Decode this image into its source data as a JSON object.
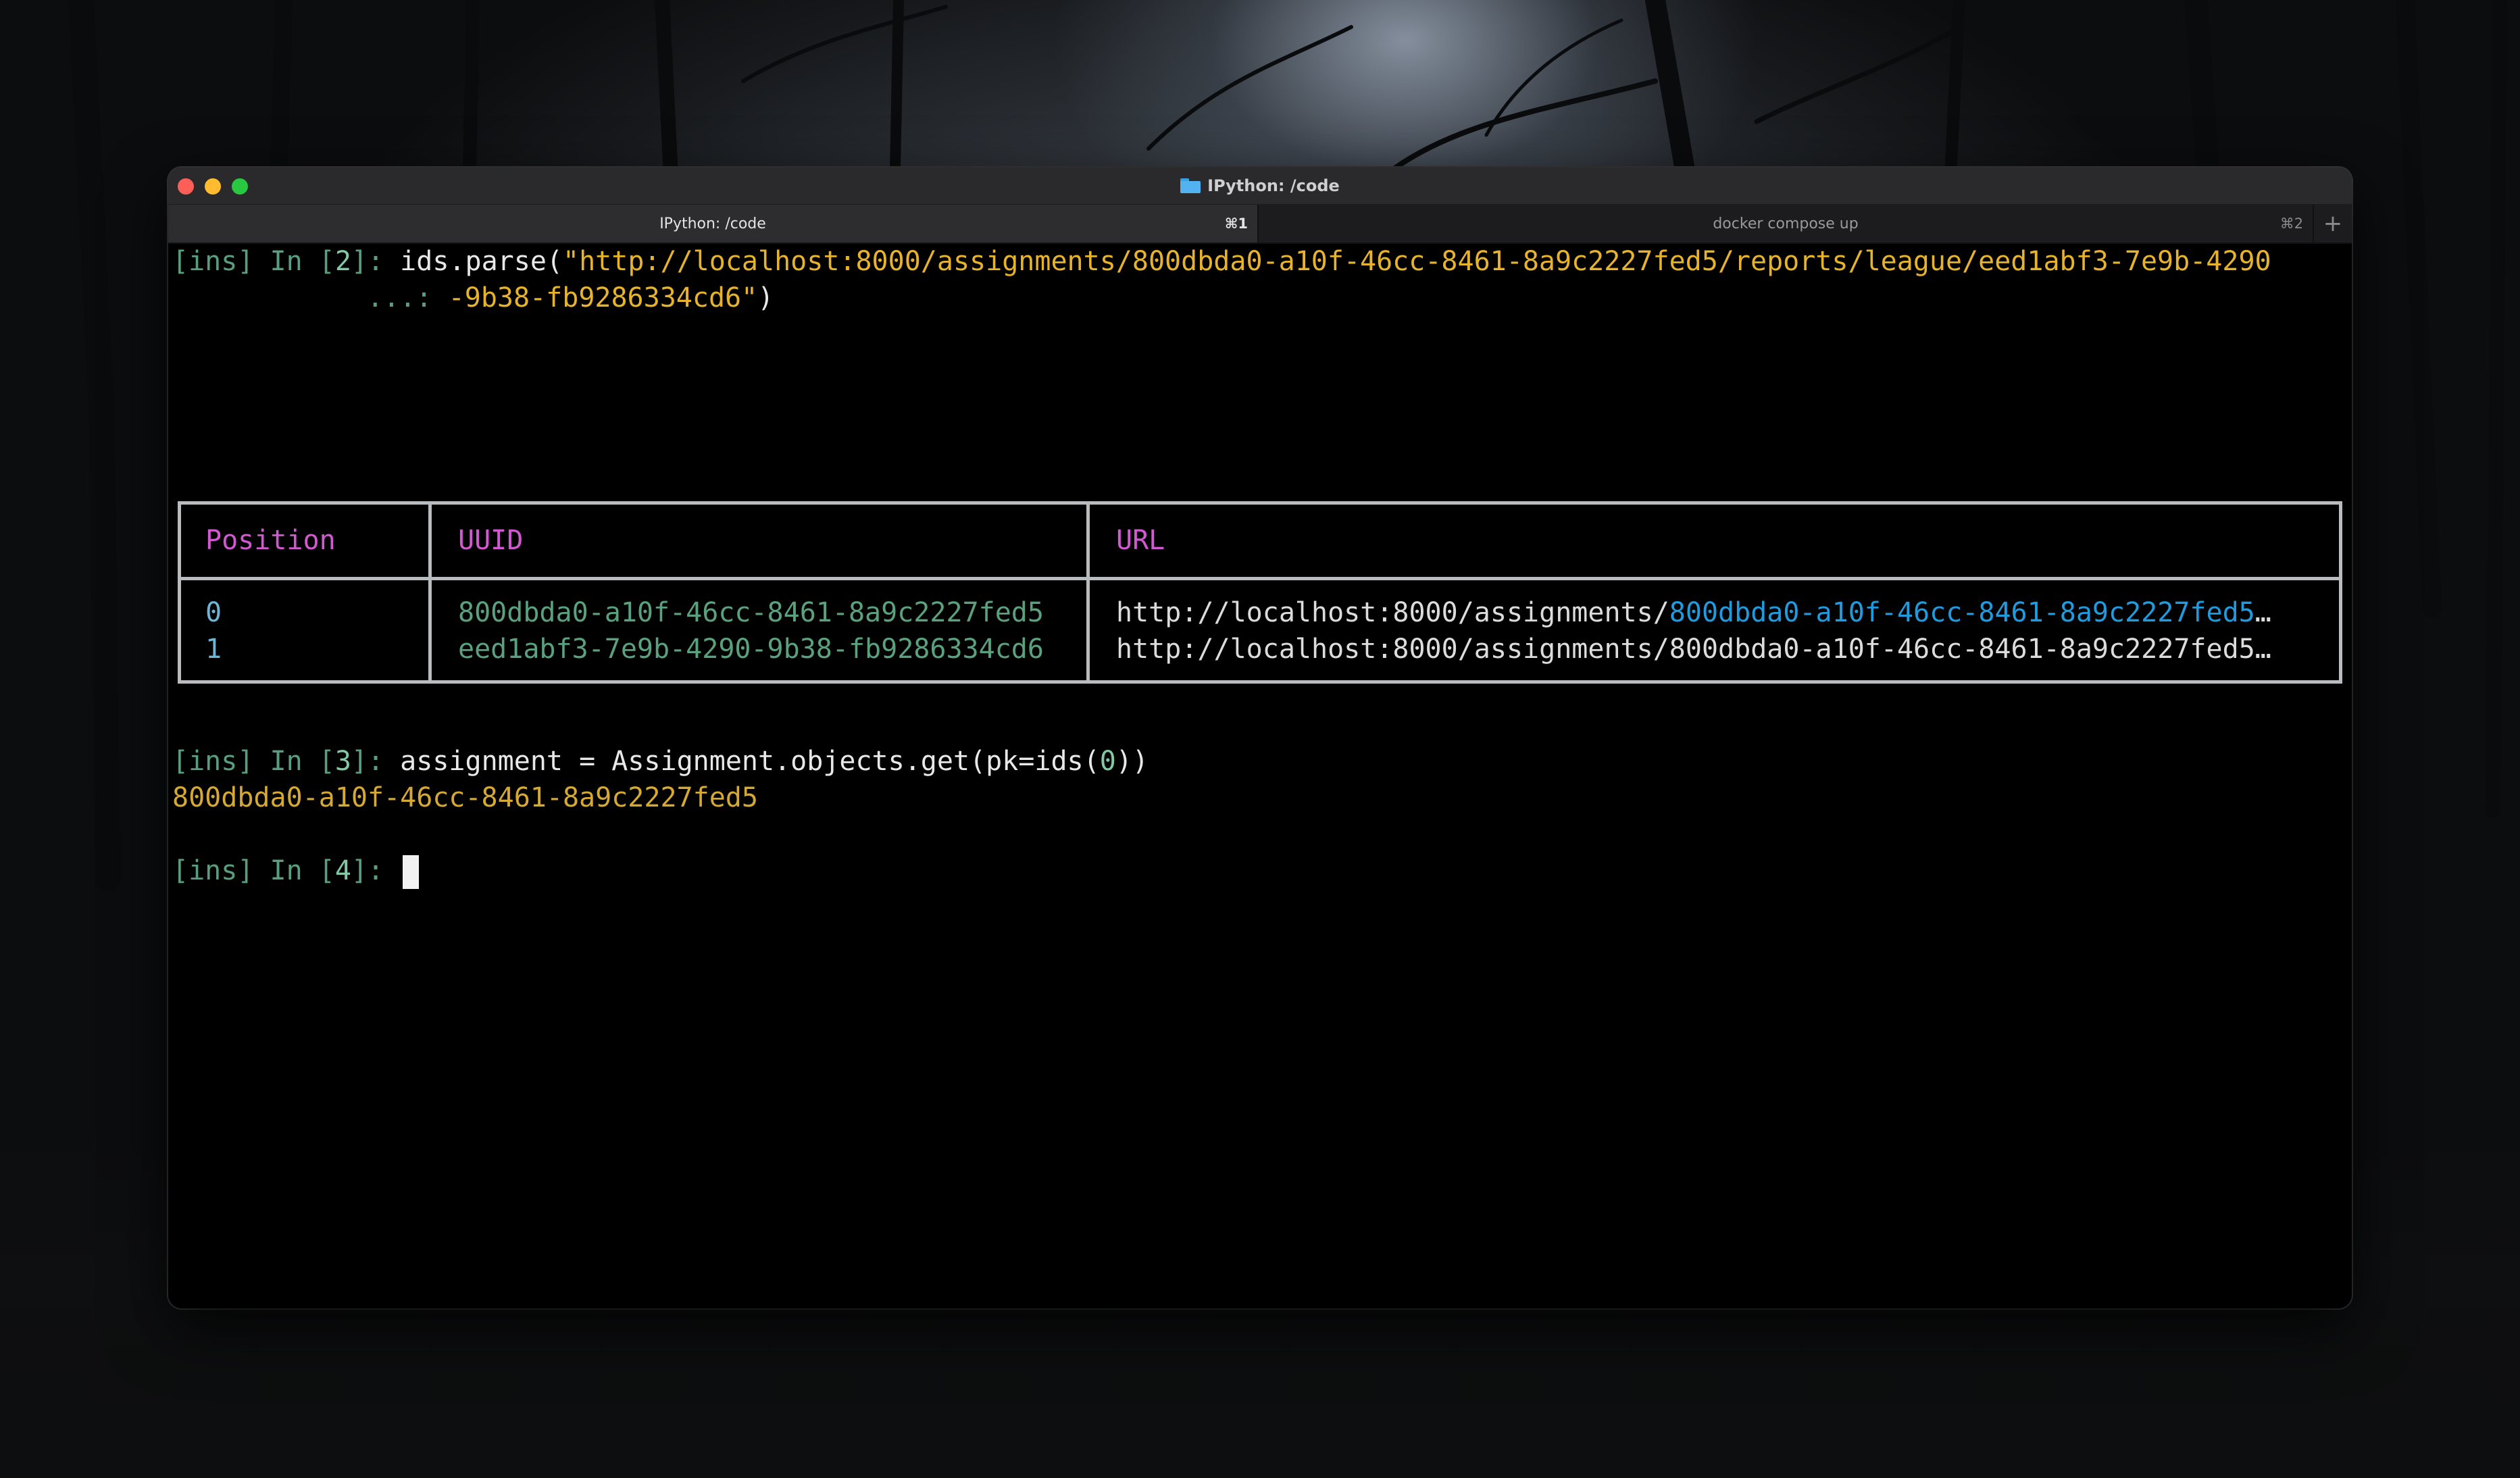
{
  "window": {
    "title": "IPython: /code"
  },
  "tabs": [
    {
      "label": "IPython: /code",
      "shortcut": "⌘1",
      "active": true
    },
    {
      "label": "docker compose up",
      "shortcut": "⌘2",
      "active": false
    }
  ],
  "tab_add_label": "+",
  "icons": {
    "title_folder": "folder-icon",
    "new_tab": "plus-icon"
  },
  "colors": {
    "prompt": "#5a9e80",
    "prompt_number": "#82c9a5",
    "string": "#e6b32a",
    "table_header": "#d259d2",
    "uuid": "#5aa17e",
    "url_highlight": "#1f9be0"
  },
  "terminal": {
    "cell2": {
      "prompt_prefix": "[ins] In [",
      "prompt_num": "2",
      "prompt_suffix": "]: ",
      "code_call": "ids.parse(",
      "code_string_line1": "\"http://localhost:8000/assignments/800dbda0-a10f-46cc-8461-8a9c2227fed5/reports/league/eed1abf3-7e9b-4290",
      "continuation_prompt": "   ...: ",
      "code_string_line2": "-9b38-fb9286334cd6\"",
      "code_close": ")"
    },
    "table": {
      "headers": [
        "Position",
        "UUID",
        "URL"
      ],
      "rows": [
        {
          "position": "0",
          "uuid": "800dbda0-a10f-46cc-8461-8a9c2227fed5",
          "url_prefix": "http://localhost:8000/assignments/",
          "url_highlight": "800dbda0-a10f-46cc-8461-8a9c2227fed5",
          "url_rest": "…"
        },
        {
          "position": "1",
          "uuid": "eed1abf3-7e9b-4290-9b38-fb9286334cd6",
          "url_prefix": "http://localhost:8000/assignments/800dbda0-a10f-46cc-8461-8a9c2227fed5",
          "url_highlight": "",
          "url_rest": "…"
        }
      ]
    },
    "cell3": {
      "prompt_prefix": "[ins] In [",
      "prompt_num": "3",
      "prompt_suffix": "]: ",
      "code_before": "assignment = Assignment.objects.get(pk=ids(",
      "code_arg": "0",
      "code_after": "))",
      "output": "800dbda0-a10f-46cc-8461-8a9c2227fed5"
    },
    "cell4": {
      "prompt_prefix": "[ins] In [",
      "prompt_num": "4",
      "prompt_suffix": "]: "
    }
  }
}
